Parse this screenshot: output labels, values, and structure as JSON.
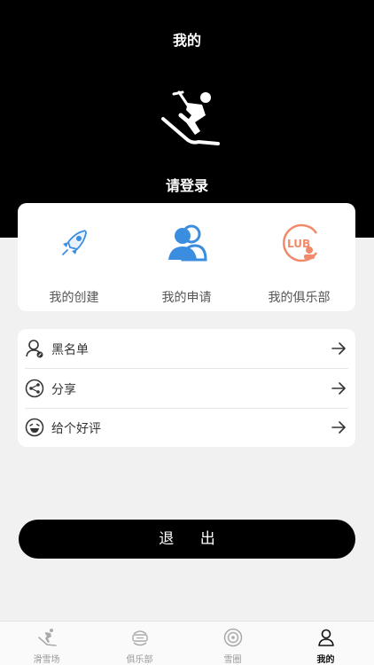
{
  "header": {
    "title": "我的",
    "login_label": "请登录"
  },
  "quick_actions": [
    {
      "label": "我的创建",
      "icon": "rocket-icon"
    },
    {
      "label": "我的申请",
      "icon": "users-icon"
    },
    {
      "label": "我的俱乐部",
      "icon": "club-icon"
    }
  ],
  "menu": [
    {
      "label": "黑名单",
      "icon": "user-block-icon"
    },
    {
      "label": "分享",
      "icon": "share-icon"
    },
    {
      "label": "给个好评",
      "icon": "smile-icon"
    }
  ],
  "logout_label": "退 出",
  "tabbar": [
    {
      "label": "滑雪场",
      "icon": "skier-icon"
    },
    {
      "label": "俱乐部",
      "icon": "club-badge-icon"
    },
    {
      "label": "雪圈",
      "icon": "circle-icon"
    },
    {
      "label": "我的",
      "icon": "person-icon",
      "active": true
    }
  ],
  "colors": {
    "header_bg": "#000000",
    "accent_blue": "#3b8de0",
    "accent_orange": "#f08a6a",
    "page_bg": "#f1f1f1"
  }
}
